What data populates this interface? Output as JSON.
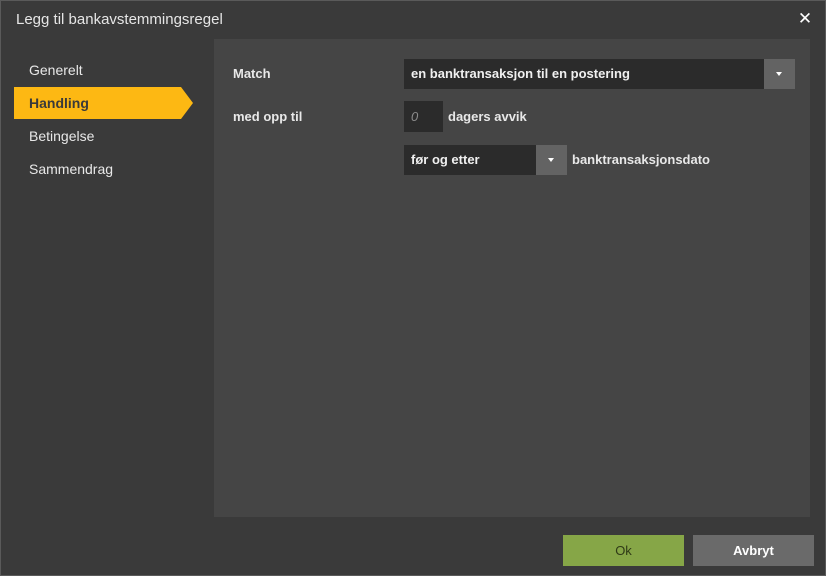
{
  "dialog": {
    "title": "Legg til bankavstemmingsregel",
    "close_glyph": "✕"
  },
  "sidebar": {
    "items": [
      {
        "label": "Generelt",
        "active": false
      },
      {
        "label": "Handling",
        "active": true
      },
      {
        "label": "Betingelse",
        "active": false
      },
      {
        "label": "Sammendrag",
        "active": false
      }
    ]
  },
  "form": {
    "match_label": "Match",
    "match_value": "en banktransaksjon til en postering",
    "range_label": "med opp til",
    "days_placeholder": "0",
    "days_suffix": "dagers avvik",
    "direction_value": "før og etter",
    "direction_suffix": "banktransaksjonsdato"
  },
  "footer": {
    "ok_label": "Ok",
    "cancel_label": "Avbryt"
  },
  "colors": {
    "accent": "#fdb813",
    "ok_button": "#86a647",
    "cancel_button": "#6a6a6a",
    "background": "#3a3a3a",
    "panel": "#454545"
  },
  "icons": {
    "close": "close-icon",
    "dropdown": "chevron-down-icon"
  }
}
